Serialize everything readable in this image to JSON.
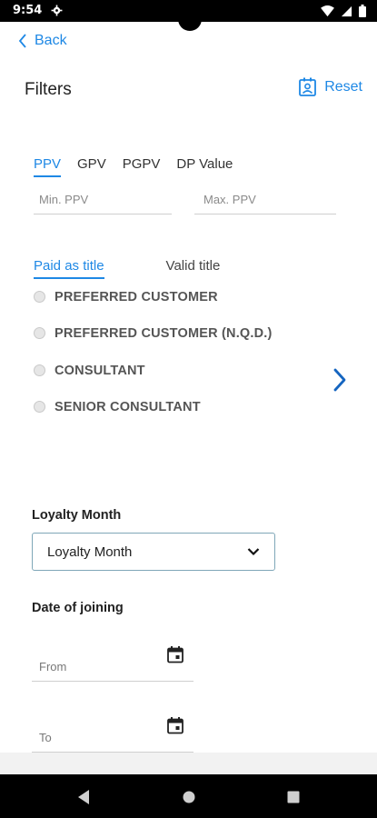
{
  "status_bar": {
    "time": "9:54"
  },
  "header": {
    "back_label": "Back",
    "title": "Filters",
    "reset_label": "Reset"
  },
  "pv_tabs": {
    "items": [
      {
        "label": "PPV",
        "active": true
      },
      {
        "label": "GPV",
        "active": false
      },
      {
        "label": "PGPV",
        "active": false
      },
      {
        "label": "DP Value",
        "active": false
      }
    ],
    "min_placeholder": "Min. PPV",
    "max_placeholder": "Max. PPV"
  },
  "title_tabs": {
    "items": [
      {
        "label": "Paid as title",
        "active": true
      },
      {
        "label": "Valid title",
        "active": false
      }
    ]
  },
  "titles": [
    "PREFERRED CUSTOMER",
    "PREFERRED CUSTOMER (N.Q.D.)",
    "CONSULTANT",
    "SENIOR CONSULTANT"
  ],
  "loyalty": {
    "label": "Loyalty Month",
    "selected": "Loyalty Month"
  },
  "date_of_joining": {
    "label": "Date of joining",
    "from_placeholder": "From",
    "to_placeholder": "To"
  },
  "colors": {
    "accent": "#1e88e5",
    "select_border": "#7fa7b8"
  },
  "icons": {
    "status": [
      "gear-icon",
      "wifi-icon",
      "signal-icon",
      "battery-icon"
    ],
    "header": [
      "chevron-left-icon",
      "contact-card-icon"
    ],
    "next": "chevron-right-icon",
    "dropdown": "chevron-down-icon",
    "date": "calendar-icon",
    "nav": [
      "nav-back-icon",
      "nav-home-icon",
      "nav-recents-icon"
    ]
  }
}
